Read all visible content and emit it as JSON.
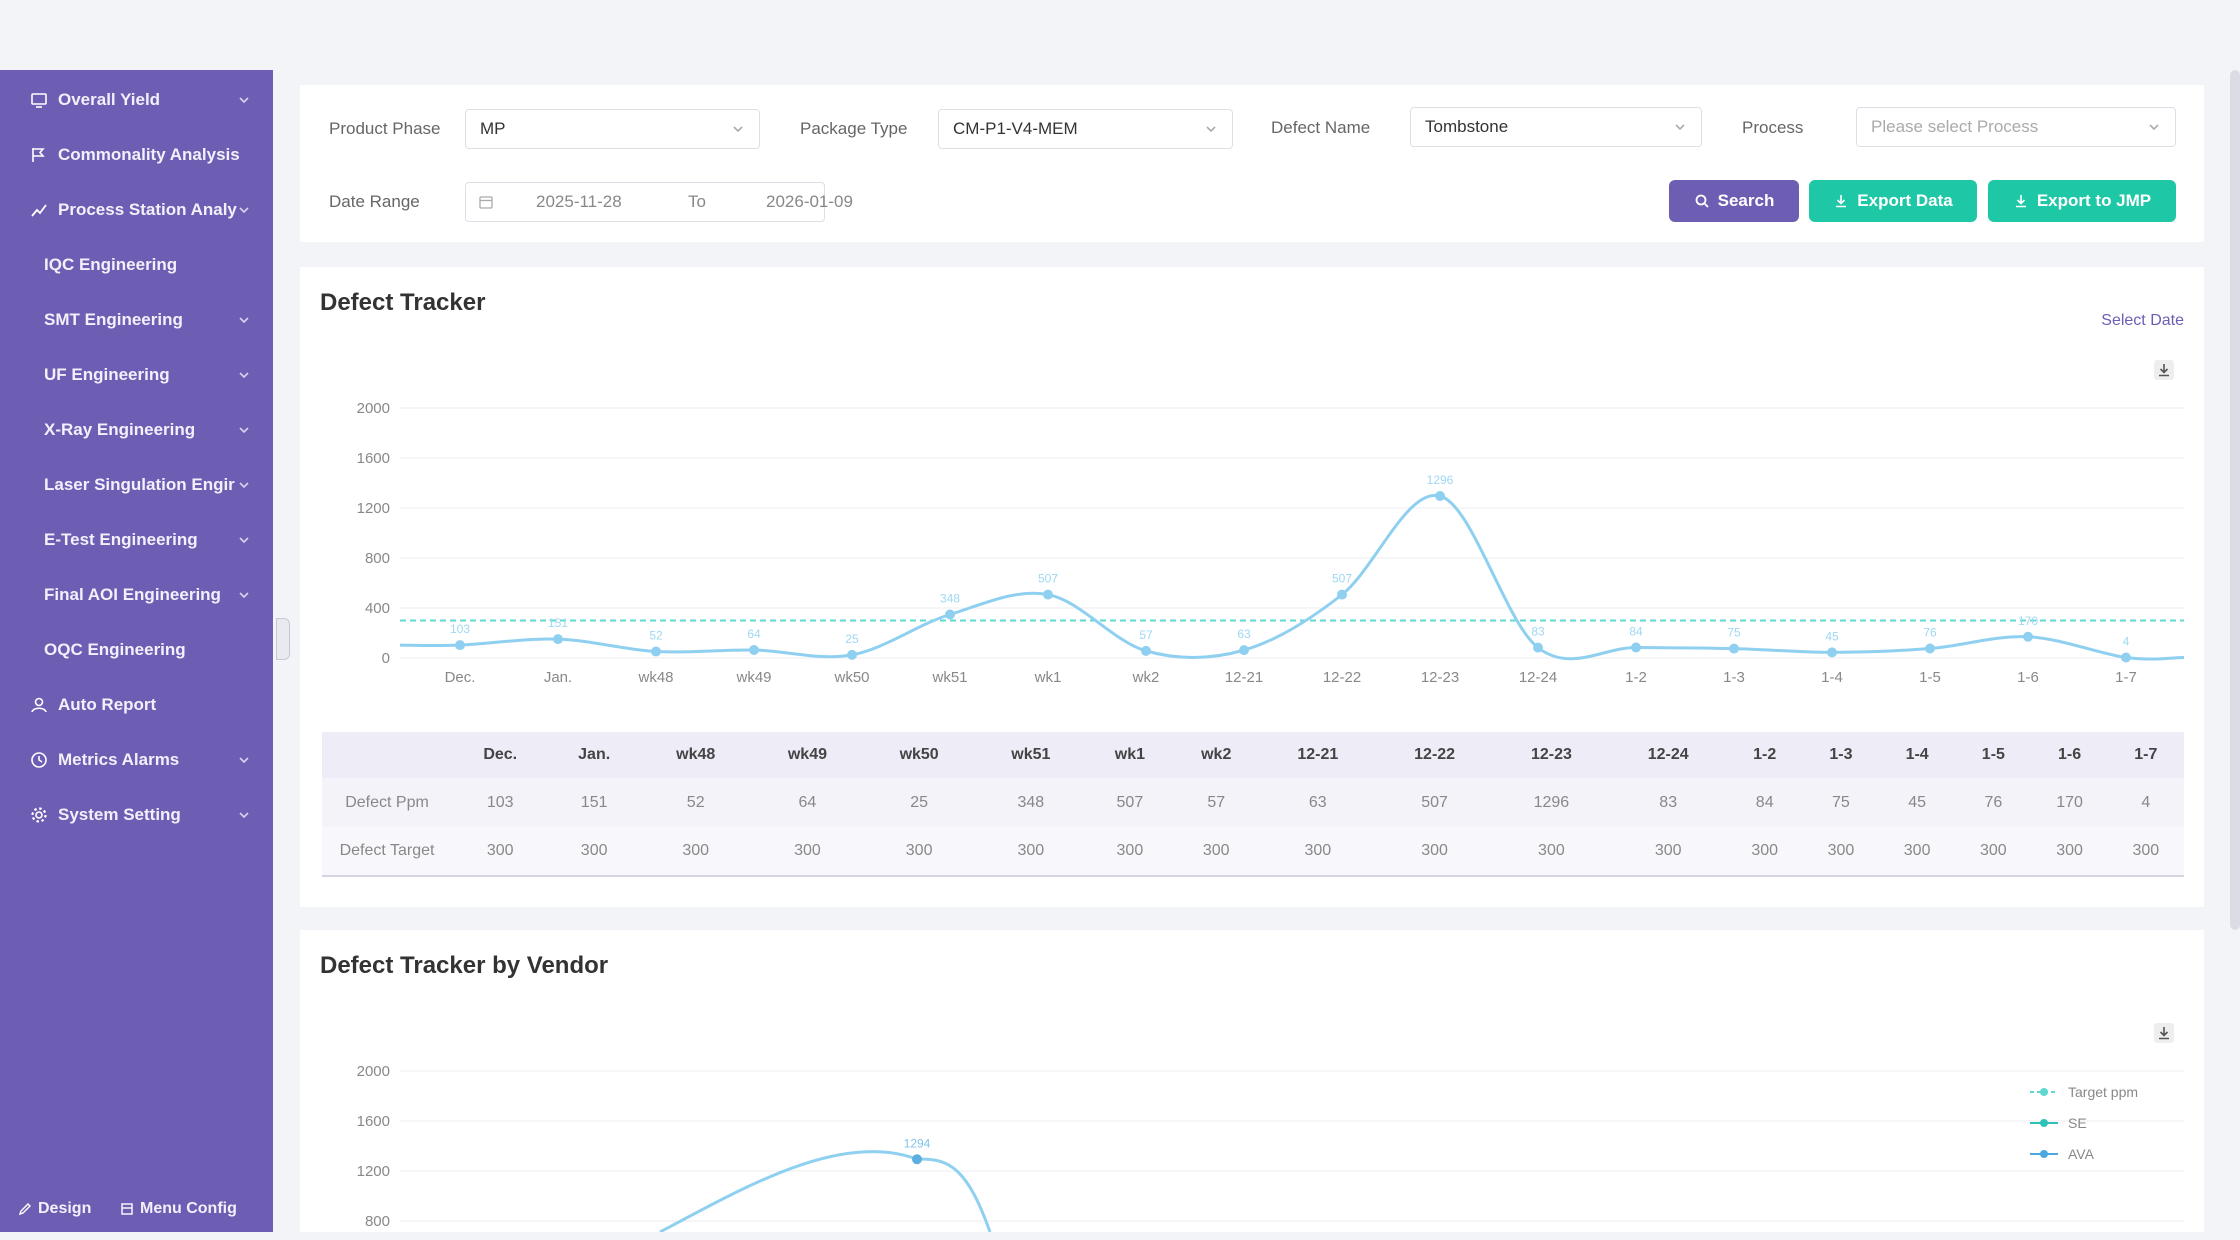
{
  "sidebar": {
    "items": [
      {
        "label": "Overall Yield",
        "icon": "monitor-icon",
        "chevron": true,
        "sub": false
      },
      {
        "label": "Commonality Analysis",
        "icon": "flag-icon",
        "chevron": false,
        "sub": false
      },
      {
        "label": "Process Station Analy",
        "icon": "chart-icon",
        "chevron": true,
        "sub": false
      },
      {
        "label": "IQC Engineering",
        "chevron": false,
        "sub": true
      },
      {
        "label": "SMT Engineering",
        "chevron": true,
        "sub": true
      },
      {
        "label": "UF Engineering",
        "chevron": true,
        "sub": true
      },
      {
        "label": "X-Ray Engineering",
        "chevron": true,
        "sub": true
      },
      {
        "label": "Laser Singulation Engir",
        "chevron": true,
        "sub": true
      },
      {
        "label": "E-Test Engineering",
        "chevron": true,
        "sub": true
      },
      {
        "label": "Final AOI Engineering",
        "chevron": true,
        "sub": true
      },
      {
        "label": "OQC Engineering",
        "chevron": false,
        "sub": true
      },
      {
        "label": "Auto Report",
        "icon": "user-icon",
        "chevron": false,
        "sub": false
      },
      {
        "label": "Metrics Alarms",
        "icon": "clock-icon",
        "chevron": true,
        "sub": false
      },
      {
        "label": "System Setting",
        "icon": "gear-icon",
        "chevron": true,
        "sub": false
      }
    ],
    "bottom": {
      "design": "Design",
      "menu_config": "Menu Config"
    }
  },
  "filters": {
    "product_phase_label": "Product Phase",
    "product_phase_value": "MP",
    "package_type_label": "Package Type",
    "package_type_value": "CM-P1-V4-MEM",
    "defect_name_label": "Defect Name",
    "defect_name_value": "Tombstone",
    "process_label": "Process",
    "process_placeholder": "Please select Process",
    "date_range_label": "Date Range",
    "date_start": "2025-11-28",
    "date_to": "To",
    "date_end": "2026-01-09"
  },
  "buttons": {
    "search": "Search",
    "export_data": "Export Data",
    "export_jmp": "Export to JMP"
  },
  "defect_tracker": {
    "title": "Defect Tracker",
    "select_date": "Select Date"
  },
  "table": {
    "row1_label": "Defect Ppm",
    "row2_label": "Defect Target"
  },
  "vendor_tracker": {
    "title": "Defect Tracker by Vendor"
  },
  "colors": {
    "sidebar": "#6e5eb3",
    "primary": "#6e5eb3",
    "teal": "#1ec7a5",
    "line": "#8fd0f0",
    "target": "#5fd9d0"
  },
  "chart_data": [
    {
      "type": "line",
      "title": "Defect Tracker",
      "categories": [
        "Dec.",
        "Jan.",
        "wk48",
        "wk49",
        "wk50",
        "wk51",
        "wk1",
        "wk2",
        "12-21",
        "12-22",
        "12-23",
        "12-24",
        "1-2",
        "1-3",
        "1-4",
        "1-5",
        "1-6",
        "1-7"
      ],
      "series": [
        {
          "name": "Defect Ppm",
          "values": [
            103,
            151,
            52,
            64,
            25,
            348,
            507,
            57,
            63,
            507,
            1296,
            83,
            84,
            75,
            45,
            76,
            170,
            4
          ]
        },
        {
          "name": "Defect Target",
          "values": [
            300,
            300,
            300,
            300,
            300,
            300,
            300,
            300,
            300,
            300,
            300,
            300,
            300,
            300,
            300,
            300,
            300,
            300
          ]
        }
      ],
      "ylim": [
        0,
        2000
      ],
      "yticks": [
        0,
        400,
        800,
        1200,
        1600,
        2000
      ]
    },
    {
      "type": "line",
      "title": "Defect Tracker by Vendor",
      "series": [
        {
          "name": "Target ppm"
        },
        {
          "name": "SE"
        },
        {
          "name": "AVA"
        }
      ],
      "peak_label": "1294",
      "ylim": [
        0,
        2000
      ],
      "yticks": [
        800,
        1200,
        1600,
        2000
      ]
    }
  ]
}
